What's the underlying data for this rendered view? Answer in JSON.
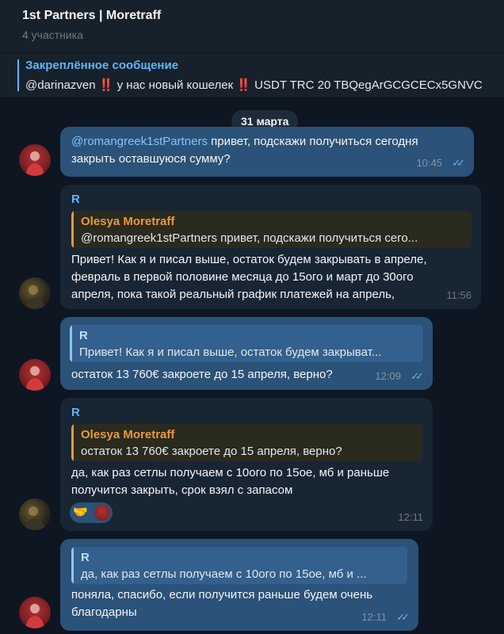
{
  "header": {
    "title": "1st Partners | Moretraff",
    "subtitle": "4 участника"
  },
  "pinned": {
    "title": "Закреплённое сообщение",
    "mention": "@darinazven",
    "warn1": "‼️",
    "text1": " у нас новый кошелек ",
    "warn2": "‼️",
    "text2": " USDT TRC 20 TBQegArGCGCECx5GNVC"
  },
  "date_pill": "31 марта",
  "messages": [
    {
      "mention": "@romangreek1stPartners",
      "line1_rest": " привет, подскажи получиться сегодня",
      "line2": "закрыть оставшуюся сумму?",
      "time": "10:45"
    },
    {
      "sender": "R",
      "quote_name": "Olesya Moretraff",
      "quote_text": "@romangreek1stPartners привет, подскажи получиться сего...",
      "line1": "Привет! Как я и писал выше, остаток будем закрывать в апреле,",
      "line2": "февраль в первой половине месяца до 15ого и март до 30ого",
      "line3": "апреля, пока такой реальный график платежей на апрель,",
      "time": "11:56"
    },
    {
      "quote_name": "R",
      "quote_text": "Привет! Как я и писал выше, остаток будем закрыват...",
      "line1": "остаток 13 760€ закроете до 15 апреля, верно?",
      "time": "12:09"
    },
    {
      "sender": "R",
      "quote_name": "Olesya Moretraff",
      "quote_text": "остаток 13 760€ закроете до 15 апреля, верно?",
      "line1": "да, как раз сетлы получаем с 10ого по 15ое, мб и раньше",
      "line2": "получится закрыть, срок взял с запасом",
      "reaction": "🤝",
      "time": "12:11"
    },
    {
      "quote_name": "R",
      "quote_text": "да, как раз сетлы получаем с 10ого по 15ое, мб и ...",
      "line1": "поняла, спасибо, если получится раньше будем очень",
      "line2": "благодарны",
      "time": "12:11"
    }
  ],
  "ticks": "✓✓",
  "colors": {
    "outgoing_bubble": "#2b5278",
    "incoming_bubble": "#182533",
    "accent": "#5eb5f7",
    "quote_orange": "#e89a3c"
  }
}
